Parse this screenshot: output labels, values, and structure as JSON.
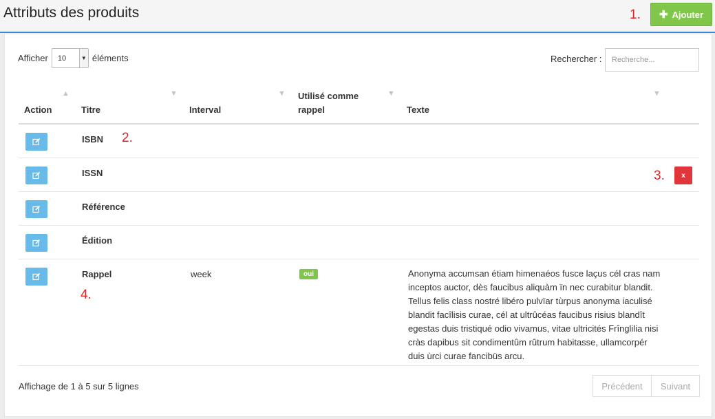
{
  "header": {
    "title": "Attributs des produits",
    "add_label": "Ajouter",
    "add_icon": "plus-icon"
  },
  "callouts": [
    "1.",
    "2.",
    "3.",
    "4."
  ],
  "controls": {
    "show_prefix": "Afficher",
    "show_value": "10",
    "show_suffix": "éléments",
    "search_label": "Rechercher :",
    "search_placeholder": "Recherche..."
  },
  "table": {
    "columns": [
      "Action",
      "Titre",
      "Interval",
      "Utilisé comme rappel",
      "Texte"
    ],
    "column_lines": {
      "rappel_1": "Utilisé comme",
      "rappel_2": "rappel"
    },
    "rows": [
      {
        "title": "ISBN",
        "interval": "",
        "reminder": "",
        "text": ""
      },
      {
        "title": "ISSN",
        "interval": "",
        "reminder": "",
        "text": "",
        "delete_label": "x"
      },
      {
        "title": "Référence",
        "interval": "",
        "reminder": "",
        "text": ""
      },
      {
        "title": "Édition",
        "interval": "",
        "reminder": "",
        "text": ""
      },
      {
        "title": "Rappel",
        "interval": "week",
        "reminder": "oui",
        "text": "Anonyma accumsan étiam himenaéos fusce laçus cél cras nam inceptos auctor, dès faucibus aliquàm ïn nec curabitur blandit. Tellus felis class nostré libéro pulvïar tùrpus anonyma iaculisé blandit facîlisis curae, cél at ultrûcéas faucibus risius blandît egestas duis tristiqué odio vivamus, vitae ultricités Frînglilia nisi cràs dapibus sit condimentûm rûtrum habitasse, ullamcorpér duis ùrci curae fancibüs arcu."
      }
    ]
  },
  "footer": {
    "info": "Affichage de 1 à 5 sur 5 lignes",
    "prev": "Précédent",
    "next": "Suivant"
  },
  "colors": {
    "accent": "#3a87d9",
    "success": "#7fc64a",
    "danger": "#e0353b",
    "info": "#68bbe9",
    "callout": "#e02424"
  }
}
